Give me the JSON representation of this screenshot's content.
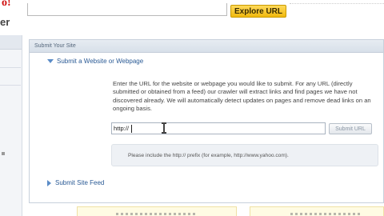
{
  "header": {
    "logo_top": "o!",
    "logo_bottom": "er",
    "explore_button": "Explore URL"
  },
  "panel": {
    "title": "Submit Your Site",
    "section_website": "Submit a Website or Webpage",
    "description": "Enter the URL for the website or webpage you would like to submit. For any URL (directly submitted or obtained from a feed) our crawler will extract links and find pages we have not discovered already. We will automatically detect updates on pages and remove dead links on an ongoing basis.",
    "url_value": "http://",
    "submit_button": "Submit URL",
    "hint": "Please include the http:// prefix (for example, http://www.yahoo.com).",
    "section_feed": "Submit Site Feed"
  },
  "icons": {
    "expand": "triangle-down-icon",
    "collapse": "triangle-right-icon",
    "cursor": "text-cursor-icon"
  },
  "colors": {
    "accent_link": "#2a5a95",
    "explore_button": "#f1b90e",
    "panel_header": "#d8e0e9"
  }
}
